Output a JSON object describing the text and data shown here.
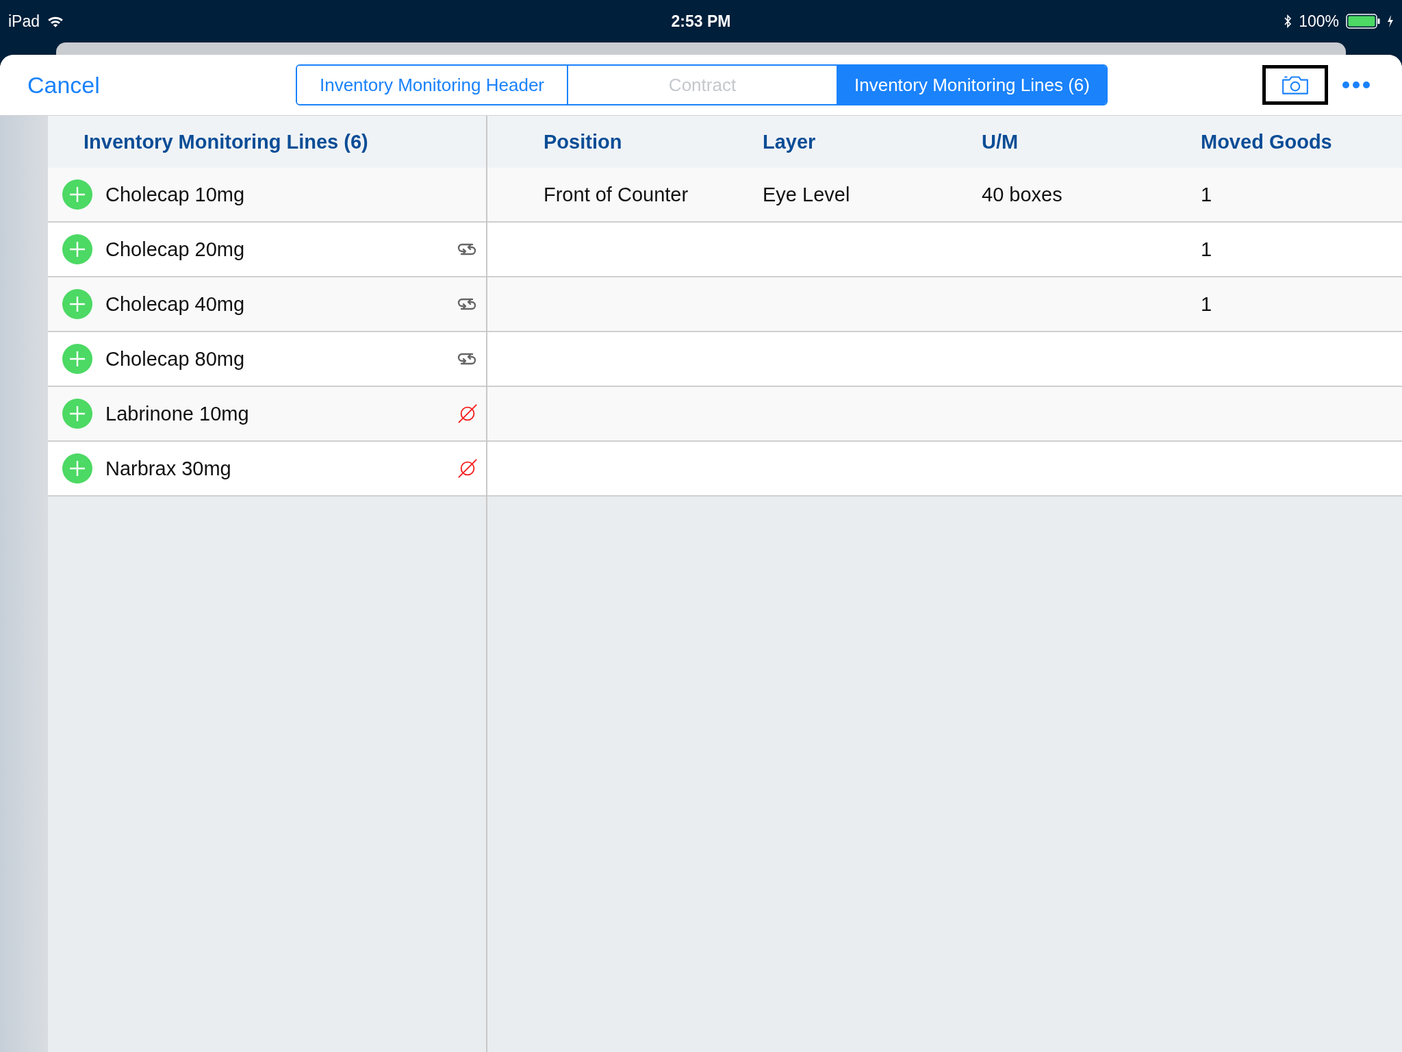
{
  "status_bar": {
    "device": "iPad",
    "time": "2:53 PM",
    "battery": "100%"
  },
  "nav": {
    "cancel": "Cancel"
  },
  "tabs": [
    {
      "label": "Inventory Monitoring Header",
      "selected": false,
      "disabled": false
    },
    {
      "label": "Contract",
      "selected": false,
      "disabled": true
    },
    {
      "label": "Inventory Monitoring Lines (6)",
      "selected": true,
      "disabled": false
    }
  ],
  "list": {
    "title": "Inventory Monitoring Lines (6)"
  },
  "table": {
    "columns": [
      "Position",
      "Layer",
      "U/M",
      "Moved Goods"
    ]
  },
  "rows": [
    {
      "name": "Cholecap 10mg",
      "kind": "none",
      "cells": [
        "Front of Counter",
        "Eye Level",
        "40 boxes",
        "1"
      ]
    },
    {
      "name": "Cholecap 20mg",
      "kind": "swap",
      "cells": [
        "",
        "",
        "",
        "1"
      ]
    },
    {
      "name": "Cholecap 40mg",
      "kind": "swap",
      "cells": [
        "",
        "",
        "",
        "1"
      ]
    },
    {
      "name": "Cholecap 80mg",
      "kind": "swap",
      "cells": [
        "",
        "",
        "",
        ""
      ]
    },
    {
      "name": "Labrinone 10mg",
      "kind": "blocked",
      "cells": [
        "",
        "",
        "",
        ""
      ]
    },
    {
      "name": "Narbrax 30mg",
      "kind": "blocked",
      "cells": [
        "",
        "",
        "",
        ""
      ]
    }
  ]
}
